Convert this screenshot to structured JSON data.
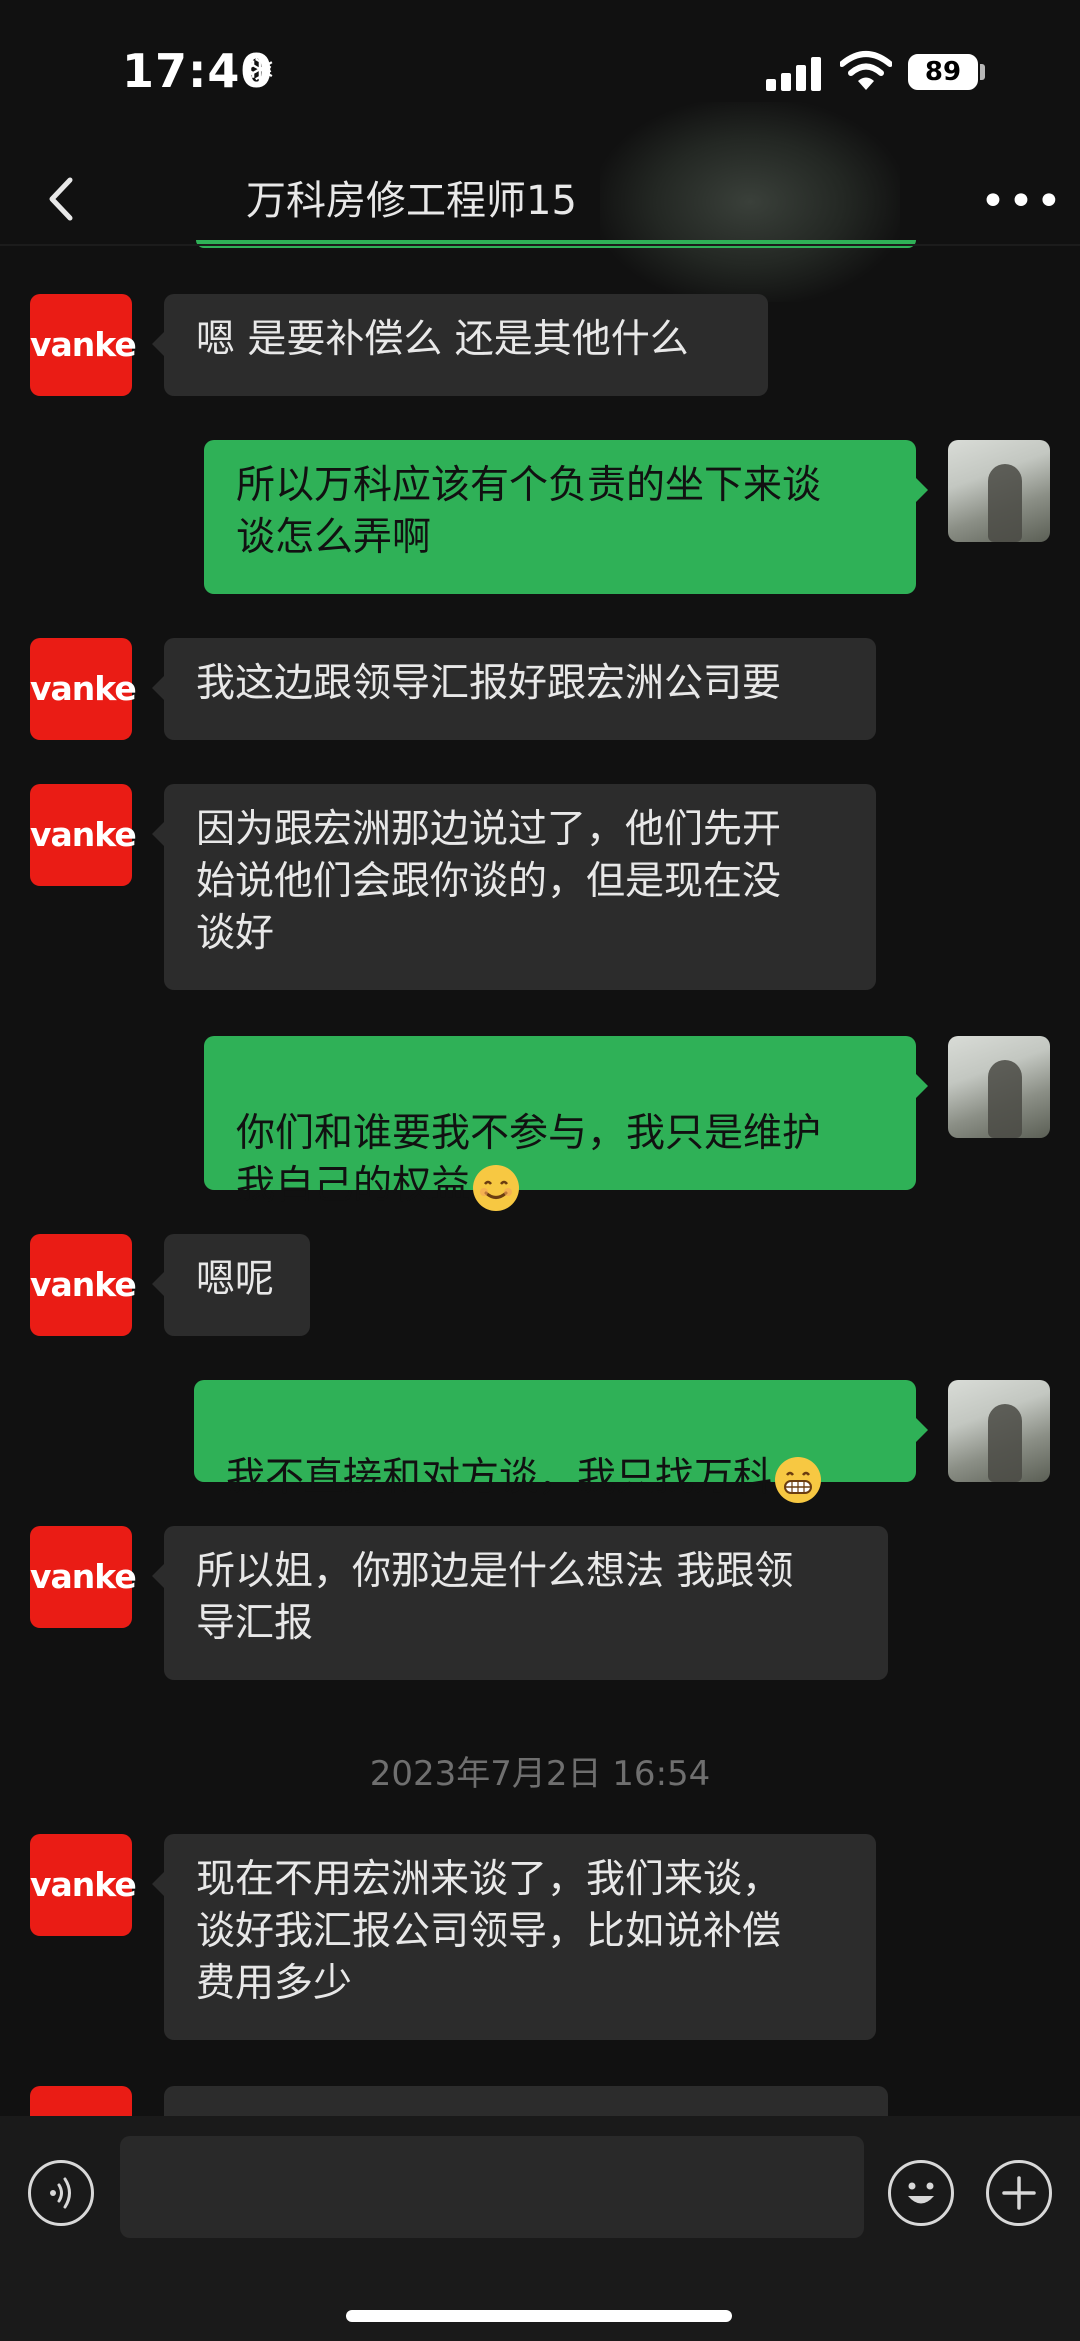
{
  "status_bar": {
    "time": "17:40",
    "time_icon": "snowflake-icon",
    "battery": "89"
  },
  "header": {
    "title": "万科房修工程师15",
    "back_icon": "back-chevron-icon",
    "more_icon": "more-dots-icon"
  },
  "messages": [
    {
      "side": "left",
      "avatar": "vanke",
      "text": "嗯 是要补偿么 还是其他什么"
    },
    {
      "side": "right",
      "text": "所以万科应该有个负责的坐下来谈\n谈怎么弄啊"
    },
    {
      "side": "left",
      "avatar": "vanke",
      "text": "我这边跟领导汇报好跟宏洲公司要"
    },
    {
      "side": "left",
      "avatar": "vanke",
      "text": "因为跟宏洲那边说过了，他们先开\n始说他们会跟你谈的，但是现在没\n谈好"
    },
    {
      "side": "right",
      "text": "你们和谁要我不参与，我只是维护\n我自己的权益",
      "emoji": "smiling-face-emoji"
    },
    {
      "side": "left",
      "avatar": "vanke",
      "text": "嗯呢"
    },
    {
      "side": "right",
      "text": "我不直接和对方谈，我只找万科",
      "emoji": "grinning-face-emoji"
    },
    {
      "side": "left",
      "avatar": "vanke",
      "text": "所以姐，你那边是什么想法 我跟领\n导汇报"
    },
    {
      "side": "left",
      "avatar": "vanke",
      "text": "现在不用宏洲来谈了，我们来谈，\n谈好我汇报公司领导，比如说补偿\n费用多少"
    }
  ],
  "timestamp": "2023年7月2日 16:54",
  "avatar_text": "vanke",
  "colors": {
    "background": "#111111",
    "bubble_left": "#2c2c2c",
    "bubble_right": "#2fb157",
    "vanke_red": "#ea1c15"
  },
  "input_bar": {
    "voice_icon": "voice-icon",
    "emoji_icon": "emoji-icon",
    "plus_icon": "plus-icon",
    "placeholder": ""
  }
}
